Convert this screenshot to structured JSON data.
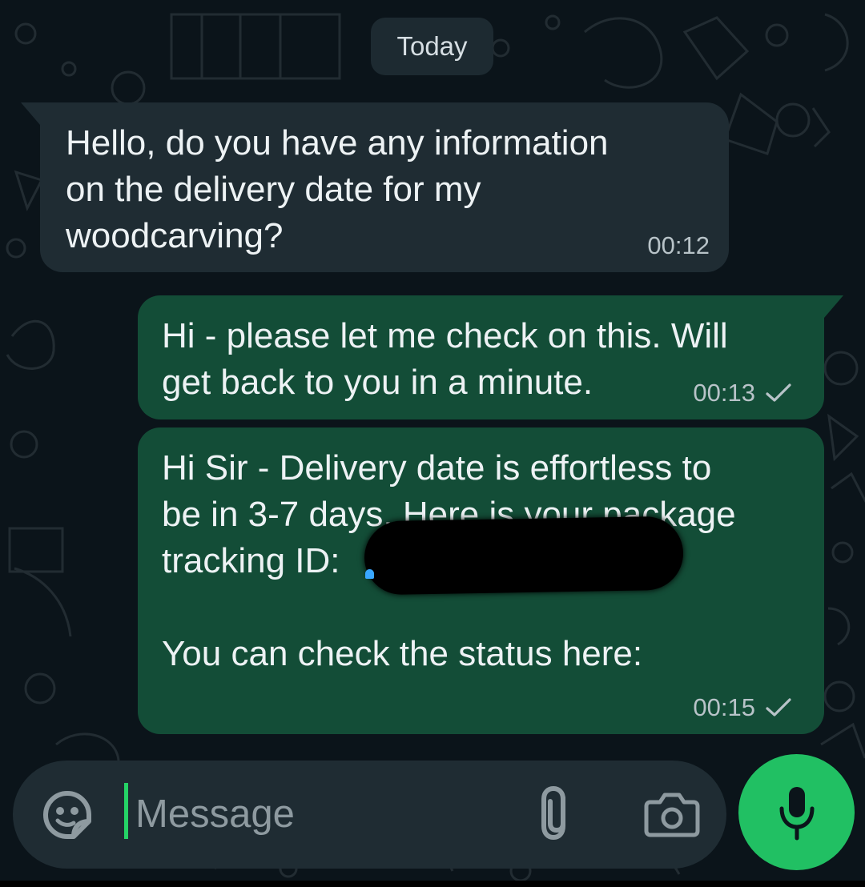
{
  "chat": {
    "date_label": "Today",
    "messages": [
      {
        "direction": "incoming",
        "text": "Hello, do you have any information\non the delivery date for my\nwoodcarving?",
        "time": "00:12"
      },
      {
        "direction": "outgoing",
        "text": "Hi - please let me check on this. Will\nget back to you in a minute.",
        "time": "00:13",
        "status_icon": "single-check-icon"
      },
      {
        "direction": "outgoing",
        "text": "Hi Sir - Delivery date is effortless to\nbe in 3-7 days. Here is your package\ntracking ID:\n\nYou can check the status here:",
        "time": "00:15",
        "status_icon": "single-check-icon",
        "redaction": "tracking-id-redacted"
      }
    ]
  },
  "composer": {
    "placeholder": "Message",
    "icons": {
      "emoji": "sticker-emoji-icon",
      "attach": "paperclip-icon",
      "camera": "camera-icon",
      "voice": "microphone-icon"
    }
  },
  "colors": {
    "background": "#0b141a",
    "incoming_bubble": "#1f2c33",
    "outgoing_bubble": "#134d37",
    "accent": "#25d366",
    "mic_button": "#21c063"
  }
}
